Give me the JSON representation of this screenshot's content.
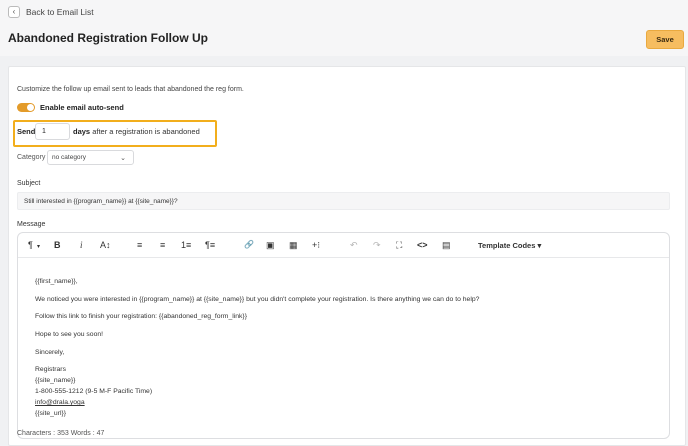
{
  "header": {
    "back_label": "Back to Email List",
    "back_icon": "chevron-left-icon",
    "title": "Abandoned Registration Follow Up",
    "save_label": "Save"
  },
  "form": {
    "description": "Customize the follow up email sent to leads that abandoned the reg form.",
    "auto_send": {
      "label": "Enable email auto-send",
      "enabled": true
    },
    "send": {
      "prefix": "Send",
      "value": "1",
      "unit": "days",
      "suffix": "after a registration is abandoned"
    },
    "category": {
      "label": "Category",
      "selected": "no category"
    },
    "subject": {
      "label": "Subject",
      "value": "Still interested in {{program_name}} at {{site_name}}?"
    },
    "message": {
      "label": "Message",
      "toolbar": {
        "paragraph": "¶",
        "bold": "B",
        "italic": "i",
        "font_size": "A↕",
        "align_left": "≡",
        "align_center": "≡",
        "ordered_list": "1≡",
        "paragraph_format": "¶≡",
        "link": "🔗",
        "image": "▣",
        "table": "▦",
        "insert": "+⁝",
        "undo": "↶",
        "redo": "↷",
        "fullscreen": "⛶",
        "code": "<>",
        "select_all": "▤",
        "template_codes": "Template Codes ▾"
      },
      "lines": {
        "greeting": "{{first_name}},",
        "body1": "We noticed you were interested in {{program_name}} at {{site_name}} but you didn't complete your registration. Is there anything we can do to help?",
        "body2": "Follow this link to finish your registration: {{abandoned_reg_form_link}}",
        "body3": "Hope to see you soon!",
        "closing": "Sincerely,",
        "sig1": "Registrars",
        "sig2": "{{site_name}}",
        "sig3": "1-800-555-1212 (9-5 M-F Pacific Time)",
        "sig4": "info@drala.yoga",
        "sig5": "{{site_url}}"
      },
      "counter": "Characters : 353 Words : 47"
    }
  },
  "colors": {
    "accent": "#f6bd60",
    "toggle": "#e39b2a",
    "highlight_border": "#f2ae1c"
  }
}
